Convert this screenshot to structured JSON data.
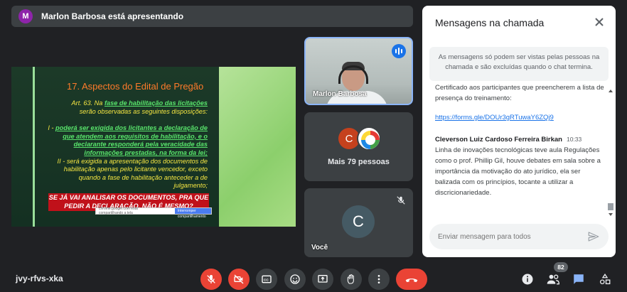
{
  "presenter": {
    "initial": "M",
    "text": "Marlon Barbosa está apresentando"
  },
  "slide": {
    "title": "17. Aspectos do Edital de Pregão",
    "art_prefix": "Art. 63. Na ",
    "art_link": "fase de habilitação das licitações",
    "art_suffix": "serão observadas as seguintes disposições:",
    "item1_prefix": "I - ",
    "item1_text": "poderá ser exigida dos licitantes a declaração de que atendem aos requisitos de habilitação, e o declarante responderá pela veracidade das informações prestadas, na forma da lei;",
    "item2": "II - será exigida a apresentação dos documentos de habilitação apenas pelo licitante vencedor, exceto quando a fase de habilitação anteceder a de julgamento;",
    "highlight": "SE JÁ VAI ANALISAR OS DOCUMENTOS, PRA QUE PEDIR A DECLARAÇÃO, NÃO É MESMO?",
    "url_text": "chrome.google.com está compartilhando a tela",
    "url_button": "Interromper compartilhamento"
  },
  "tiles": {
    "speaker_name": "Marlon Barbosa",
    "others_initial": "C",
    "others_label": "Mais 79 pessoas",
    "you_initial": "C",
    "you_label": "Você"
  },
  "chat": {
    "title": "Mensagens na chamada",
    "notice": "As mensagens só podem ser vistas pelas pessoas na chamada e são excluídas quando o chat termina.",
    "message1": "Certificado aos participantes que preencherem a lista de presença do treinamento:",
    "link": "https://forms.gle/DOUr3gRTuwaY6ZQj9",
    "sender": "Cleverson Luiz Cardoso Ferreira Birkan",
    "time": "10:33",
    "message2": "Linha de inovações tecnológicas teve aula Regulações como o prof. Phillip Gil, houve debates em sala sobre a importância da motivação do ato jurídico, ela ser balizada com os princípios, tocante a utilizar a discricionariedade.",
    "input_placeholder": "Enviar mensagem para todos"
  },
  "toolbar": {
    "meeting_code": "jvy-rfvs-xka",
    "participants_count": "82"
  },
  "icons": [
    "mic-off-icon",
    "camera-off-icon",
    "captions-icon",
    "emoji-icon",
    "present-icon",
    "raise-hand-icon",
    "more-options-icon",
    "end-call-icon",
    "info-icon",
    "people-icon",
    "chat-icon",
    "activities-icon",
    "close-icon",
    "send-icon"
  ],
  "colors": {
    "background": "#202124",
    "accent_blue": "#1a73e8",
    "danger_red": "#ea4335"
  }
}
